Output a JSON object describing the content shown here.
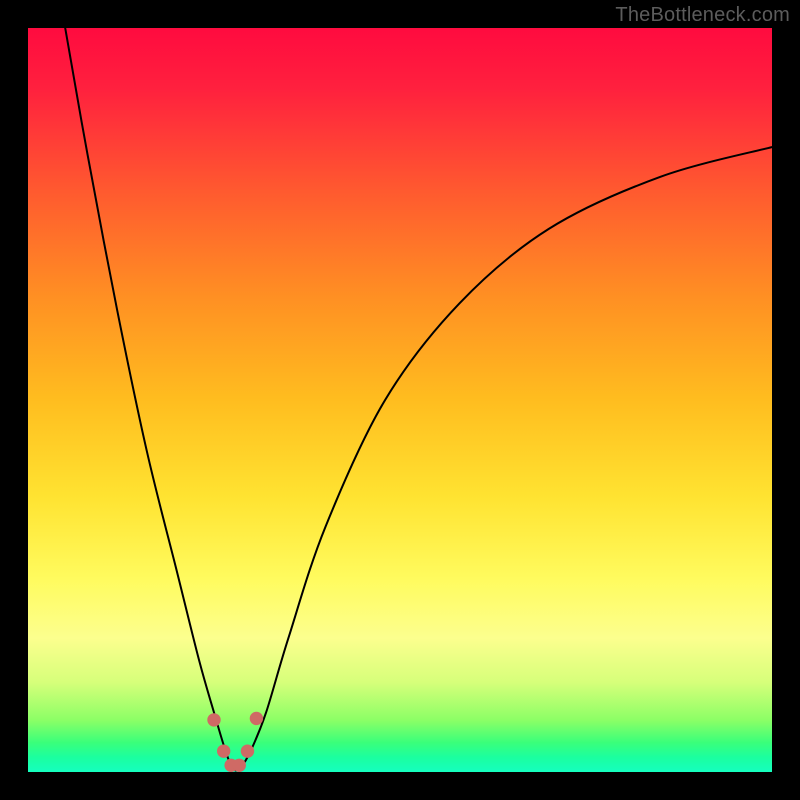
{
  "watermark": "TheBottleneck.com",
  "chart_data": {
    "type": "line",
    "title": "",
    "xlabel": "",
    "ylabel": "",
    "xlim": [
      0,
      100
    ],
    "ylim": [
      0,
      100
    ],
    "grid": false,
    "legend": false,
    "note": "V-shaped bottleneck curve over vertical red→green gradient; values are estimated pixel-relative (%) since axes are unlabeled.",
    "series": [
      {
        "name": "curve",
        "color": "#000000",
        "x": [
          5,
          8,
          12,
          16,
          20,
          23,
          25,
          26.5,
          27.5,
          28.5,
          30,
          32,
          35,
          40,
          48,
          58,
          70,
          85,
          100
        ],
        "y": [
          100,
          83,
          62,
          43,
          27,
          15,
          8,
          3,
          0.5,
          0.5,
          3,
          8,
          18,
          33,
          50,
          63,
          73,
          80,
          84
        ]
      }
    ],
    "markers": {
      "name": "valley-dots",
      "color": "#cf6a65",
      "radius_pct": 0.9,
      "points": [
        {
          "x": 25.0,
          "y": 7.0
        },
        {
          "x": 26.3,
          "y": 2.8
        },
        {
          "x": 27.3,
          "y": 0.9
        },
        {
          "x": 28.4,
          "y": 0.9
        },
        {
          "x": 29.5,
          "y": 2.8
        },
        {
          "x": 30.7,
          "y": 7.2
        }
      ]
    },
    "gradient_stops": [
      {
        "pos": 0,
        "color": "#ff0b3f"
      },
      {
        "pos": 8,
        "color": "#ff203e"
      },
      {
        "pos": 22,
        "color": "#ff5a2f"
      },
      {
        "pos": 36,
        "color": "#ff8f23"
      },
      {
        "pos": 50,
        "color": "#ffbd1f"
      },
      {
        "pos": 63,
        "color": "#ffe331"
      },
      {
        "pos": 74,
        "color": "#fffb5e"
      },
      {
        "pos": 82,
        "color": "#fcff8e"
      },
      {
        "pos": 88,
        "color": "#d6ff7a"
      },
      {
        "pos": 93,
        "color": "#8cff66"
      },
      {
        "pos": 96,
        "color": "#3bff7a"
      },
      {
        "pos": 98,
        "color": "#1bff9f"
      },
      {
        "pos": 100,
        "color": "#15ffbf"
      }
    ]
  }
}
